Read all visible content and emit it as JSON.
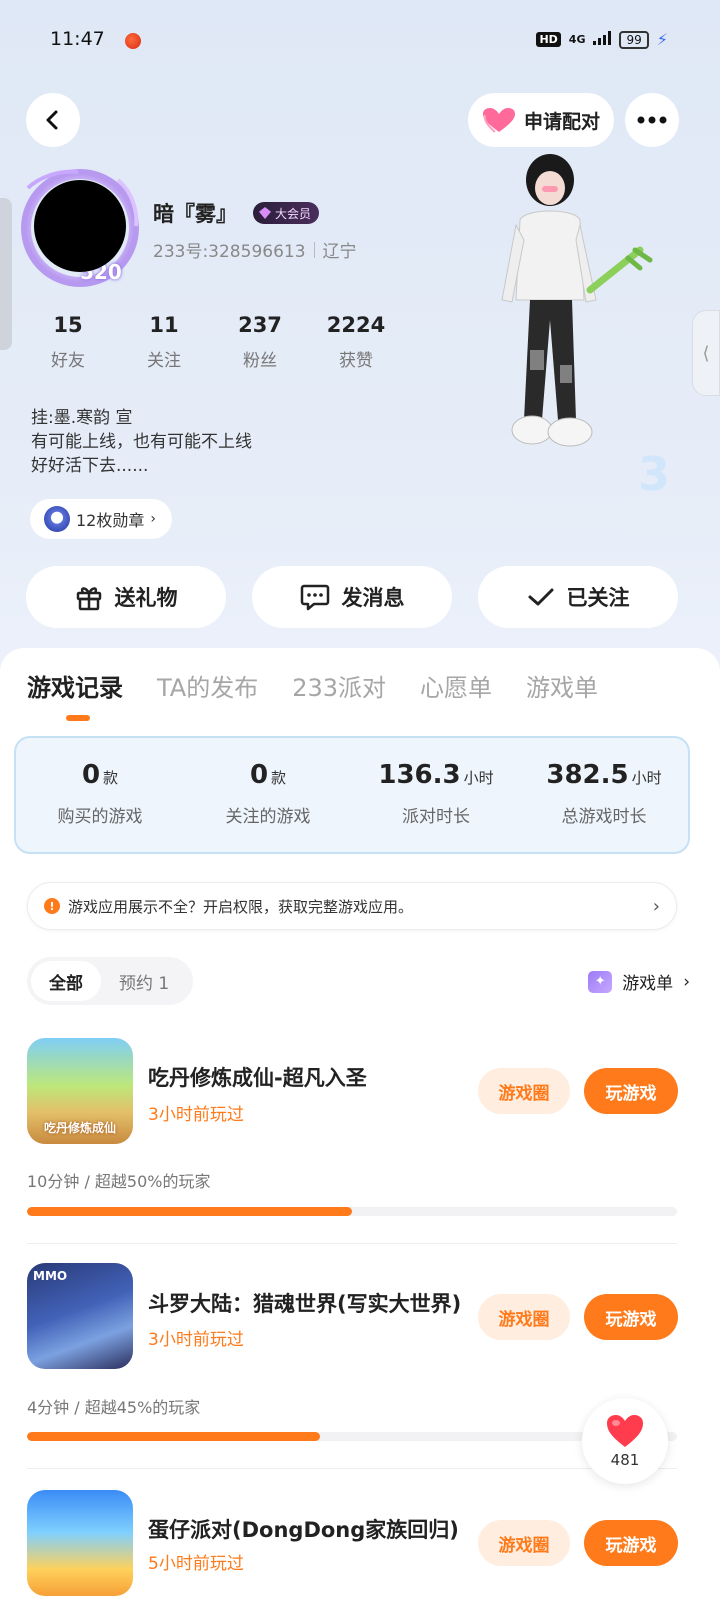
{
  "status_bar": {
    "time": "11:47",
    "network": "4G",
    "hd": "HD",
    "battery": "99"
  },
  "header": {
    "pair_label": "申请配对"
  },
  "profile": {
    "nickname": "暗『雾』",
    "vip_label": "大会员",
    "uid": "233号:328596613",
    "location": "辽宁",
    "frame_number": "520",
    "stats": [
      {
        "value": "15",
        "label": "好友"
      },
      {
        "value": "11",
        "label": "关注"
      },
      {
        "value": "237",
        "label": "粉丝"
      },
      {
        "value": "2224",
        "label": "获赞"
      }
    ],
    "bio_lines": [
      "挂:墨.寒韵 宣",
      "有可能上线，也有可能不上线",
      "好好活下去......"
    ],
    "medals": "12枚勋章"
  },
  "actions": {
    "gift": "送礼物",
    "message": "发消息",
    "follow": "已关注"
  },
  "tabs": [
    "游戏记录",
    "TA的发布",
    "233派对",
    "心愿单",
    "游戏单"
  ],
  "summary": [
    {
      "value": "0",
      "unit": "款",
      "label": "购买的游戏"
    },
    {
      "value": "0",
      "unit": "款",
      "label": "关注的游戏"
    },
    {
      "value": "136.3",
      "unit": "小时",
      "label": "派对时长"
    },
    {
      "value": "382.5",
      "unit": "小时",
      "label": "总游戏时长"
    }
  ],
  "notice": "游戏应用展示不全？开启权限，获取完整游戏应用。",
  "filters": {
    "all": "全部",
    "reserve": "预约 1"
  },
  "gamelist_link": "游戏单",
  "games": [
    {
      "title": "吃丹修炼成仙-超凡入圣",
      "icon_text": "吃丹修炼成仙",
      "last_played": "3小时前玩过",
      "progress_text": "10分钟 / 超越50%的玩家",
      "progress": 0.5,
      "circle_label": "游戏圈",
      "play_label": "玩游戏"
    },
    {
      "title": "斗罗大陆：猎魂世界(写实大世界)",
      "icon_text": "MMO",
      "last_played": "3小时前玩过",
      "progress_text": "4分钟 / 超越45%的玩家",
      "progress": 0.45,
      "circle_label": "游戏圈",
      "play_label": "玩游戏"
    },
    {
      "title": "蛋仔派对(DongDong家族回归)",
      "icon_text": "",
      "last_played": "5小时前玩过",
      "circle_label": "游戏圈",
      "play_label": "玩游戏"
    }
  ],
  "like": {
    "count": "481"
  },
  "colors": {
    "accent": "#ff7a1a",
    "vip": "#d88cf8"
  }
}
